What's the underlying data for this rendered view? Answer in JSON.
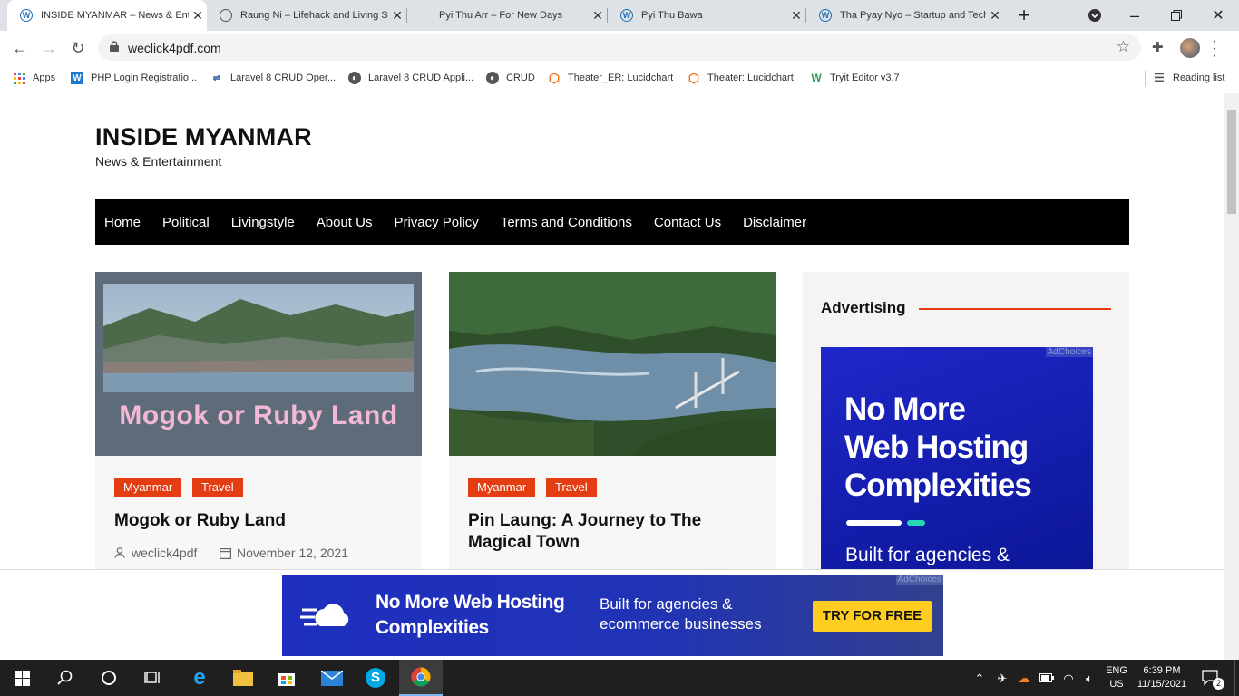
{
  "browser": {
    "tabs": [
      {
        "title": "INSIDE MYANMAR – News & Entertainment",
        "active": true
      },
      {
        "title": "Raung Ni – Lifehack and Living Style",
        "active": false
      },
      {
        "title": "Pyi Thu Arr – For New Days",
        "active": false
      },
      {
        "title": "Pyi Thu Bawa",
        "active": false
      },
      {
        "title": "Tha Pyay Nyo – Startup and Technology",
        "active": false
      }
    ],
    "url": "weclick4pdf.com",
    "bookmarks": [
      {
        "label": "Apps",
        "icon": "apps-grid-icon"
      },
      {
        "label": "PHP Login Registratio...",
        "icon": "w-icon"
      },
      {
        "label": "Laravel 8 CRUD Oper...",
        "icon": "code-icon"
      },
      {
        "label": "Laravel 8 CRUD Appli...",
        "icon": "globe-icon"
      },
      {
        "label": "CRUD",
        "icon": "globe-icon"
      },
      {
        "label": "Theater_ER: Lucidchart",
        "icon": "lucidchart-icon"
      },
      {
        "label": "Theater: Lucidchart",
        "icon": "lucidchart-icon"
      },
      {
        "label": "Tryit Editor v3.7",
        "icon": "w3-icon"
      }
    ],
    "reading_list": "Reading list"
  },
  "site": {
    "title": "INSIDE MYANMAR",
    "tagline": "News & Entertainment",
    "nav": [
      "Home",
      "Political",
      "Livingstyle",
      "About Us",
      "Privacy Policy",
      "Terms and Conditions",
      "Contact Us",
      "Disclaimer"
    ]
  },
  "posts": [
    {
      "image_text": "Mogok or Ruby Land",
      "categories": [
        "Myanmar",
        "Travel"
      ],
      "title": "Mogok or Ruby Land",
      "author": "weclick4pdf",
      "date": "November 12, 2021"
    },
    {
      "categories": [
        "Myanmar",
        "Travel"
      ],
      "title": "Pin Laung: A Journey to The Magical Town"
    }
  ],
  "sidebar": {
    "heading": "Advertising",
    "ad": {
      "adchoices": "AdChoices",
      "headline_lines": [
        "No More",
        "Web Hosting",
        "Complexities"
      ],
      "subline": "Built for agencies &"
    }
  },
  "bottom_ad": {
    "adchoices": "AdChoices",
    "headline_lines": [
      "No More Web Hosting",
      "Complexities"
    ],
    "sub_lines": [
      "Built for agencies &",
      "ecommerce businesses"
    ],
    "cta": "TRY FOR FREE"
  },
  "taskbar": {
    "language": [
      "ENG",
      "US"
    ],
    "time": "6:39 PM",
    "date": "11/15/2021",
    "notifications": "2"
  },
  "colors": {
    "accent": "#e43d12",
    "nav_bg": "#000000",
    "ad_blue": "#1f27c9",
    "cta_yellow": "#ffcd1f"
  }
}
